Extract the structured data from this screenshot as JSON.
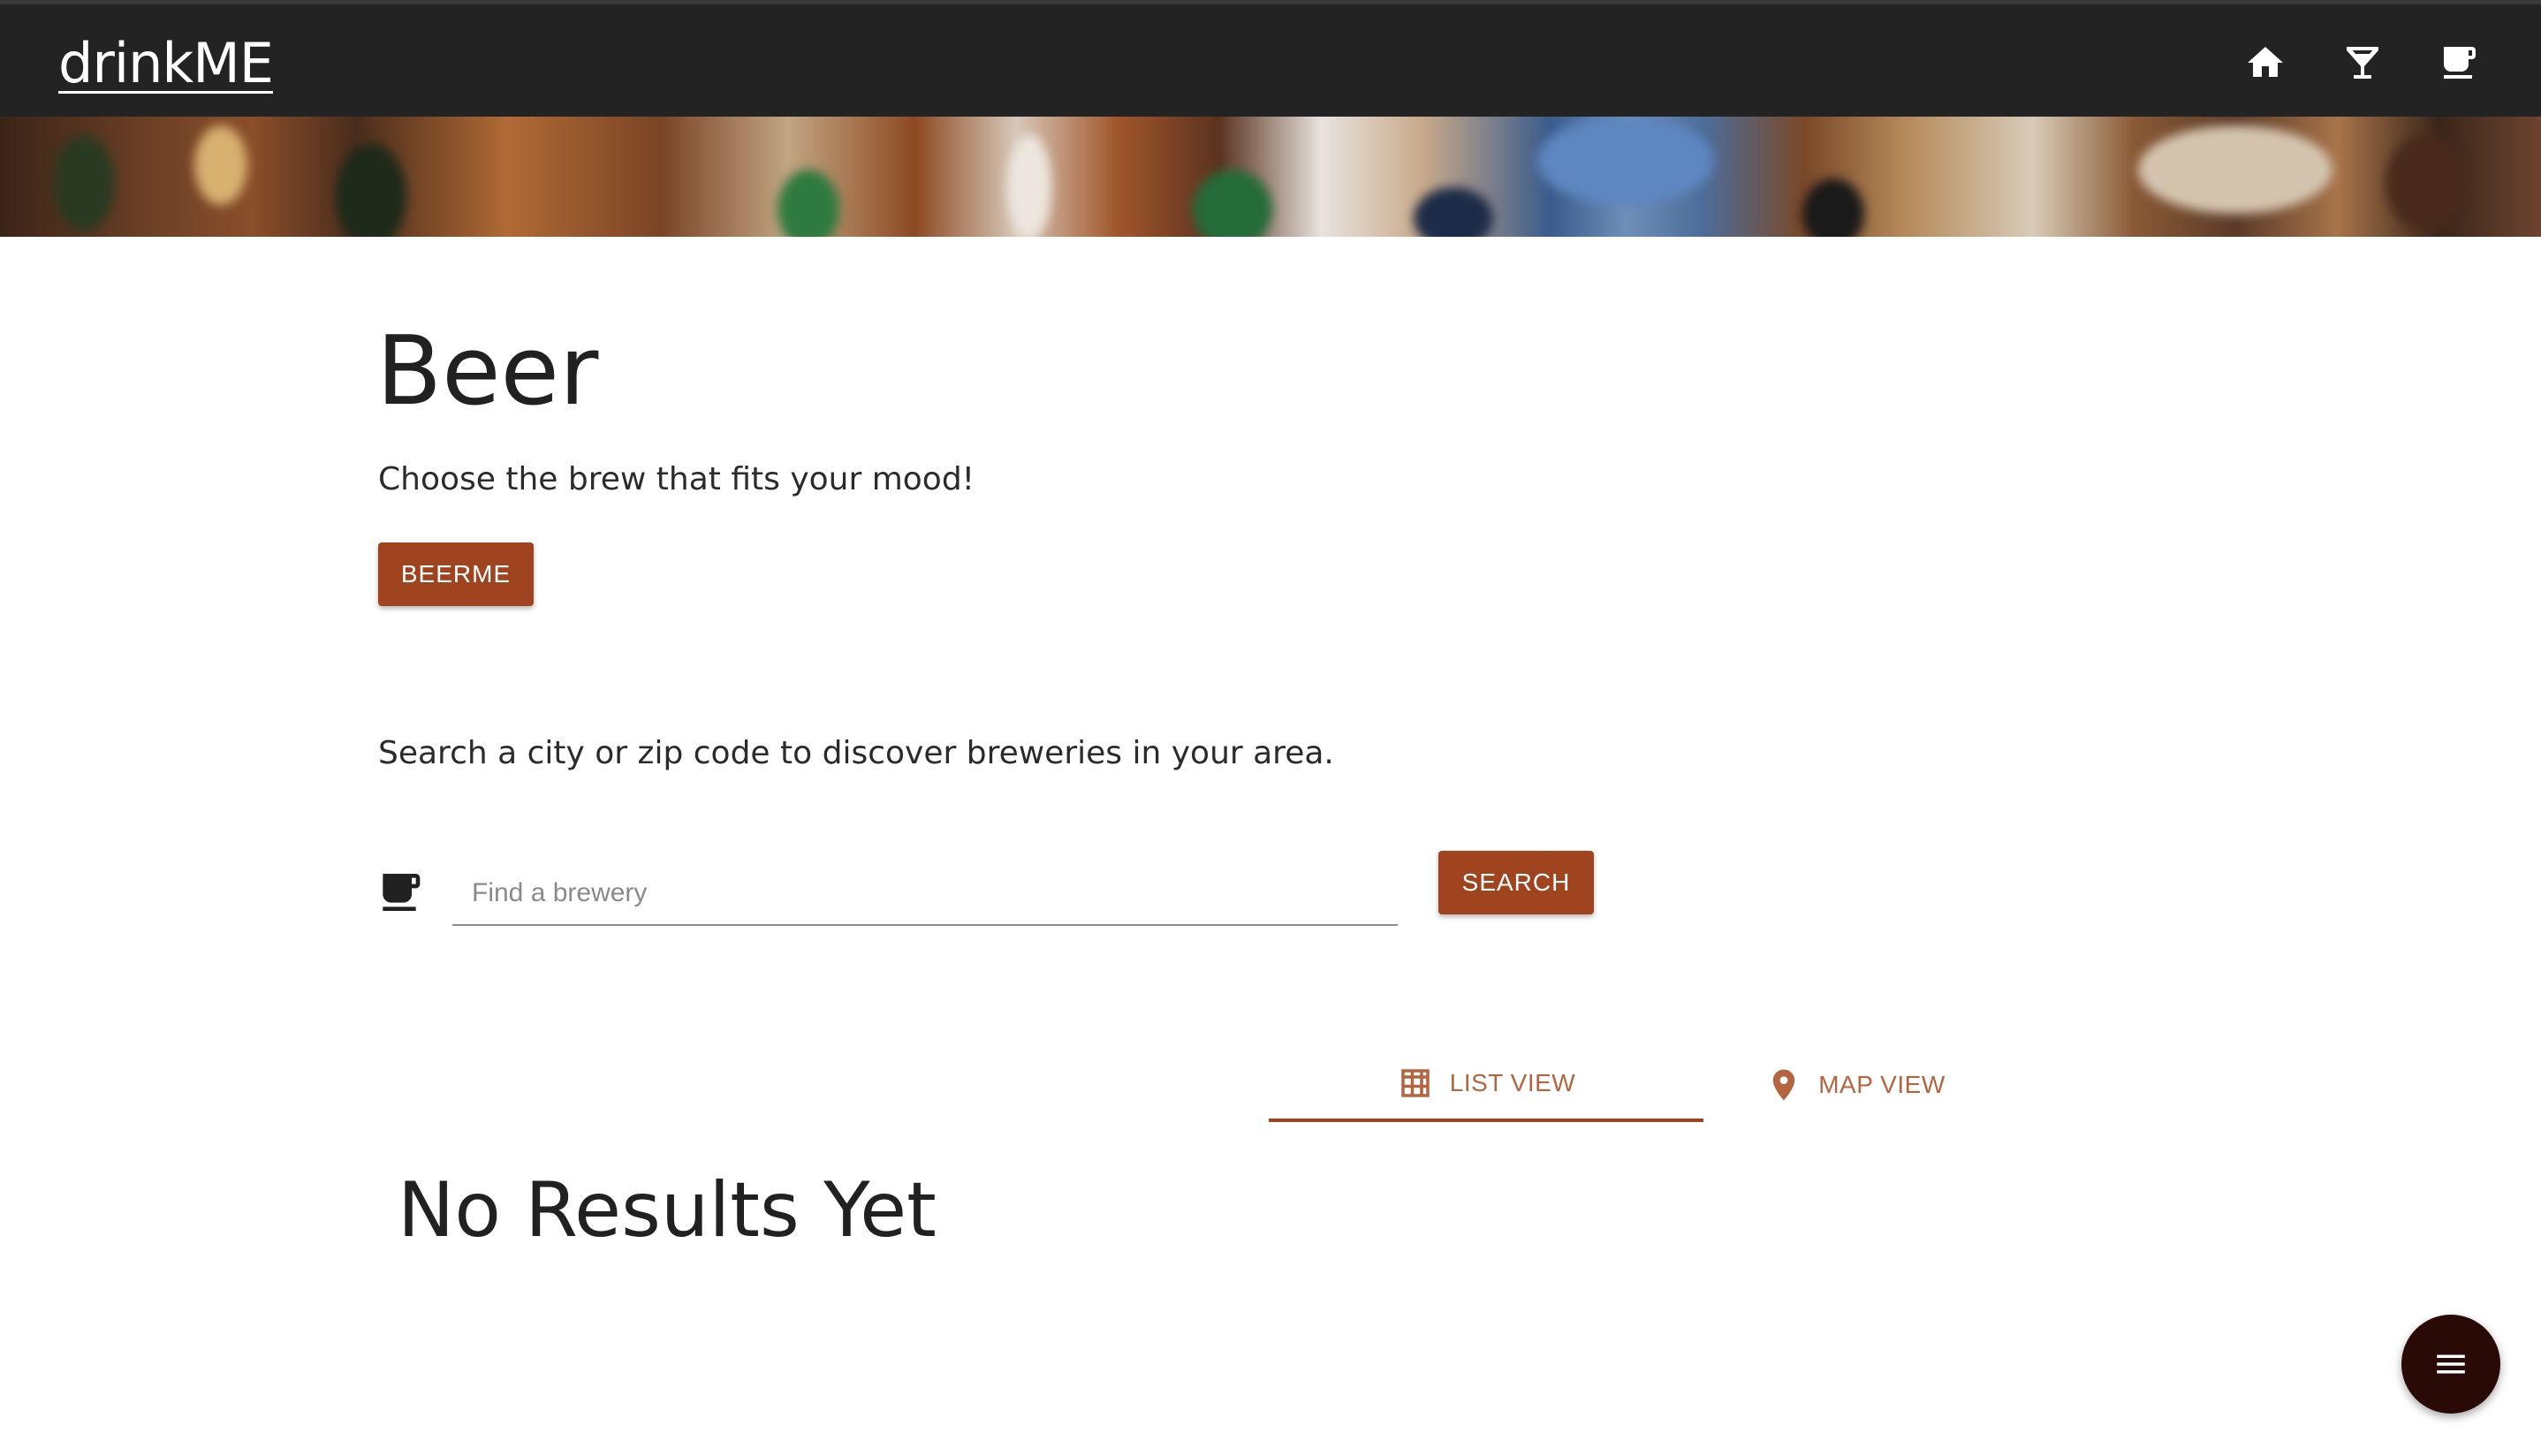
{
  "app": {
    "brand": "drinkME"
  },
  "nav": {
    "icons": [
      "home-icon",
      "cocktail-icon",
      "coffee-mug-icon"
    ],
    "icon_color": "#ffffff"
  },
  "hero": {
    "title": "Beer",
    "subtitle": "Choose the brew that fits your mood!",
    "cta_label": "BEERME"
  },
  "search": {
    "hint": "Search a city or zip code to discover breweries in your area.",
    "placeholder": "Find a brewery",
    "value": "",
    "button_label": "SEARCH"
  },
  "tabs": [
    {
      "label": "LIST VIEW",
      "icon": "grid-icon",
      "active": true
    },
    {
      "label": "MAP VIEW",
      "icon": "map-pin-icon",
      "active": false
    }
  ],
  "results": {
    "empty_message": "No Results Yet"
  },
  "fab": {
    "icon": "menu-icon"
  },
  "colors": {
    "topbar": "#232323",
    "accent": "#a0431f",
    "tab_text": "#b4643e",
    "fab": "#2a0a06"
  }
}
